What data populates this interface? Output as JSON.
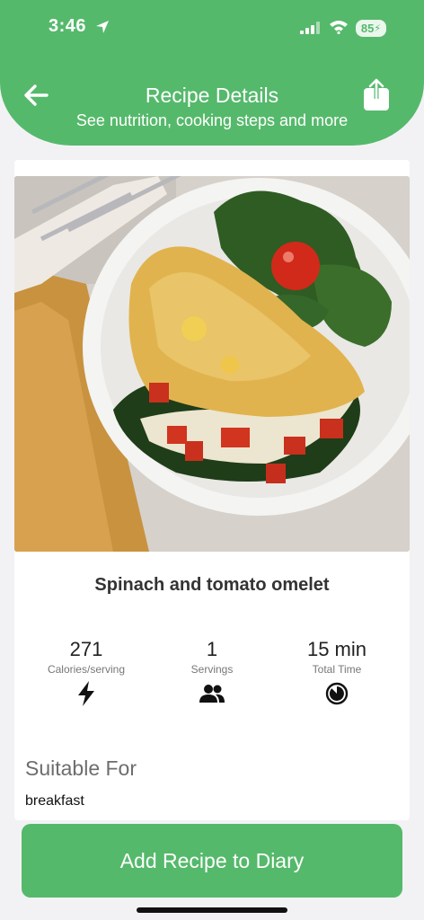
{
  "status_bar": {
    "time": "3:46",
    "battery": "85"
  },
  "header": {
    "title": "Recipe Details",
    "subtitle": "See nutrition, cooking steps and more",
    "back_icon": "arrow-left-icon",
    "share_icon": "share-icon"
  },
  "recipe": {
    "name": "Spinach and tomato omelet",
    "image": "omelet-photo",
    "stats": [
      {
        "value": "271",
        "label": "Calories/serving",
        "icon": "bolt-icon"
      },
      {
        "value": "1",
        "label": "Servings",
        "icon": "people-icon"
      },
      {
        "value": "15 min",
        "label": "Total Time",
        "icon": "timer-icon"
      }
    ],
    "suitable_for": {
      "heading": "Suitable For",
      "value": "breakfast"
    }
  },
  "actions": {
    "add_label": "Add Recipe to Diary"
  },
  "colors": {
    "brand": "#55b96b"
  }
}
